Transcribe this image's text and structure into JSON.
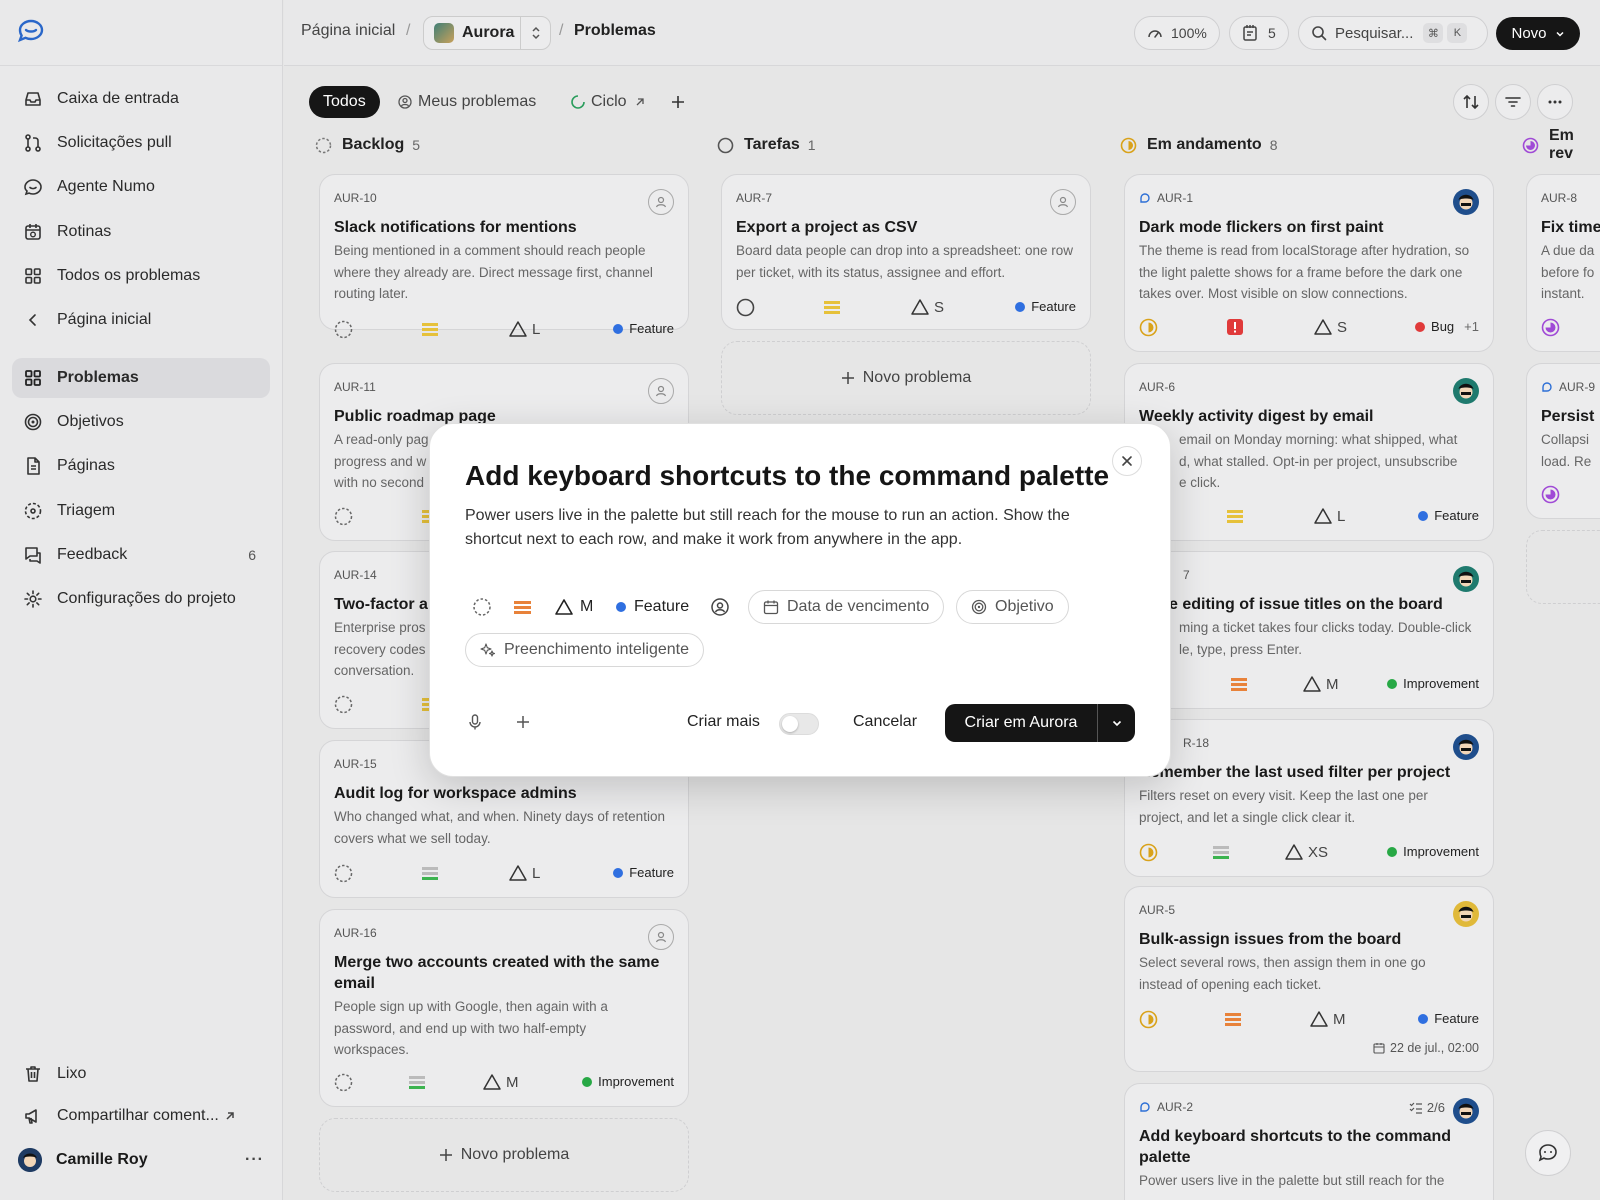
{
  "sidebar": {
    "items": [
      {
        "label": "Caixa de entrada",
        "icon": "inbox-icon"
      },
      {
        "label": "Solicitações pull",
        "icon": "pull-request-icon"
      },
      {
        "label": "Agente Numo",
        "icon": "agent-icon"
      },
      {
        "label": "Rotinas",
        "icon": "routine-icon"
      },
      {
        "label": "Todos os problemas",
        "icon": "grid-icon"
      },
      {
        "label": "Página inicial",
        "icon": "chevron-left-icon"
      },
      {
        "label": "Problemas",
        "icon": "grid-icon",
        "active": true
      },
      {
        "label": "Objetivos",
        "icon": "target-icon"
      },
      {
        "label": "Páginas",
        "icon": "page-icon"
      },
      {
        "label": "Triagem",
        "icon": "triage-icon"
      },
      {
        "label": "Feedback",
        "icon": "feedback-icon",
        "count": "6"
      },
      {
        "label": "Configurações do projeto",
        "icon": "gear-icon"
      },
      {
        "label": "Lixo",
        "icon": "trash-icon"
      },
      {
        "label": "Compartilhar coment...",
        "icon": "megaphone-icon"
      }
    ],
    "user": {
      "name": "Camille Roy",
      "more": "···"
    }
  },
  "topbar": {
    "crumb_home": "Página inicial",
    "sep": "/",
    "project": "Aurora",
    "crumb_current": "Problemas",
    "zoom": "100%",
    "notes_count": "5",
    "search_placeholder": "Pesquisar...",
    "kbd_cmd": "⌘",
    "kbd_k": "K",
    "new_button": "Novo"
  },
  "toolbar": {
    "tabs": [
      {
        "label": "Todos"
      },
      {
        "label": "Meus problemas"
      },
      {
        "label": "Ciclo"
      }
    ]
  },
  "columns": [
    {
      "name": "Backlog",
      "count": "5"
    },
    {
      "name": "Tarefas",
      "count": "1"
    },
    {
      "name": "Em andamento",
      "count": "8"
    },
    {
      "name": "Em rev",
      "count": ""
    }
  ],
  "new_issue_label": "Novo problema",
  "cards": {
    "aur10": {
      "id": "AUR-10",
      "title": "Slack notifications for mentions",
      "desc": "Being mentioned in a comment should reach people where they already are. Direct message first, channel routing later.",
      "estimate": "L",
      "type": "Feature"
    },
    "aur11": {
      "id": "AUR-11",
      "title": "Public roadmap page",
      "desc": "A read-only pag progress and w with no second"
    },
    "aur14": {
      "id": "AUR-14",
      "title": "Two-factor a",
      "desc": "Enterprise pros recovery codes conversation."
    },
    "aur15": {
      "id": "AUR-15",
      "title": "Audit log for workspace admins",
      "desc": "Who changed what, and when. Ninety days of retention covers what we sell today.",
      "estimate": "L",
      "type": "Feature"
    },
    "aur16": {
      "id": "AUR-16",
      "title": "Merge two accounts created with the same email",
      "desc": "People sign up with Google, then again with a password, and end up with two half-empty workspaces.",
      "estimate": "M",
      "type": "Improvement"
    },
    "aur7": {
      "id": "AUR-7",
      "title": "Export a project as CSV",
      "desc": "Board data people can drop into a spreadsheet: one row per ticket, with its status, assignee and effort.",
      "estimate": "S",
      "type": "Feature"
    },
    "aur1": {
      "id": "AUR-1",
      "title": "Dark mode flickers on first paint",
      "desc": "The theme is read from localStorage after hydration, so the light palette shows for a frame before the dark one takes over. Most visible on slow connections.",
      "estimate": "S",
      "type": "Bug",
      "extra": "+1"
    },
    "aur6": {
      "id": "AUR-6",
      "title": "Weekly activity digest by email",
      "desc_l1": "email on Monday morning: what shipped, what",
      "desc_l2": "d, what stalled. Opt-in per project, unsubscribe",
      "desc_l3": "e click.",
      "estimate": "L",
      "type": "Feature"
    },
    "aur_x7": {
      "id": "7",
      "title": "e editing of issue titles on the board",
      "desc_l1": "ming a ticket takes four clicks today. Double-click",
      "desc_l2": "le, type, press Enter.",
      "estimate": "M",
      "type": "Improvement"
    },
    "aur18": {
      "id": "R-18",
      "title": "Remember the last used filter per project",
      "desc": "Filters reset on every visit. Keep the last one per project, and let a single click clear it.",
      "estimate": "XS",
      "type": "Improvement"
    },
    "aur5": {
      "id": "AUR-5",
      "title": "Bulk-assign issues from the board",
      "desc": "Select several rows, then assign them in one go instead of opening each ticket.",
      "estimate": "M",
      "type": "Feature",
      "due": "22 de jul., 02:00"
    },
    "aur2": {
      "id": "AUR-2",
      "title": "Add keyboard shortcuts to the command palette",
      "desc": "Power users live in the palette but still reach for the",
      "subtasks": "2/6"
    },
    "aur8": {
      "id": "AUR-8",
      "title": "Fix time",
      "desc_l1": "A due da",
      "desc_l2": "before fo",
      "desc_l3": "instant."
    },
    "aur9": {
      "id": "AUR-9",
      "title": "Persist",
      "desc_l1": "Collapsi",
      "desc_l2": "load. Re"
    }
  },
  "modal": {
    "title": "Add keyboard shortcuts to the command palette",
    "description": "Power users live in the palette but still reach for the mouse to run an action. Show the shortcut next to each row, and make it work from anywhere in the app.",
    "estimate": "M",
    "type": "Feature",
    "due_date": "Data de vencimento",
    "goal": "Objetivo",
    "smart_fill": "Preenchimento inteligente",
    "create_more": "Criar mais",
    "cancel": "Cancelar",
    "create": "Criar em Aurora"
  },
  "colors": {
    "feature": "#2f6fe0",
    "improvement": "#27a845",
    "bug": "#e03a3a",
    "in_progress": "#d9a21a",
    "in_review": "#a04ad6"
  }
}
